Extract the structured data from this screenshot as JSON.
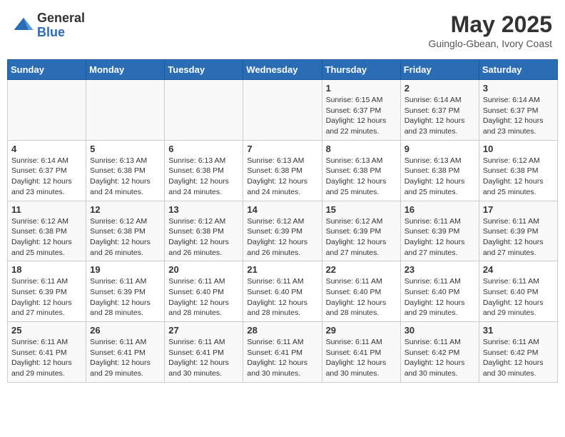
{
  "header": {
    "logo_general": "General",
    "logo_blue": "Blue",
    "month_title": "May 2025",
    "subtitle": "Guinglo-Gbean, Ivory Coast"
  },
  "weekdays": [
    "Sunday",
    "Monday",
    "Tuesday",
    "Wednesday",
    "Thursday",
    "Friday",
    "Saturday"
  ],
  "weeks": [
    [
      {
        "day": "",
        "info": ""
      },
      {
        "day": "",
        "info": ""
      },
      {
        "day": "",
        "info": ""
      },
      {
        "day": "",
        "info": ""
      },
      {
        "day": "1",
        "info": "Sunrise: 6:15 AM\nSunset: 6:37 PM\nDaylight: 12 hours\nand 22 minutes."
      },
      {
        "day": "2",
        "info": "Sunrise: 6:14 AM\nSunset: 6:37 PM\nDaylight: 12 hours\nand 23 minutes."
      },
      {
        "day": "3",
        "info": "Sunrise: 6:14 AM\nSunset: 6:37 PM\nDaylight: 12 hours\nand 23 minutes."
      }
    ],
    [
      {
        "day": "4",
        "info": "Sunrise: 6:14 AM\nSunset: 6:37 PM\nDaylight: 12 hours\nand 23 minutes."
      },
      {
        "day": "5",
        "info": "Sunrise: 6:13 AM\nSunset: 6:38 PM\nDaylight: 12 hours\nand 24 minutes."
      },
      {
        "day": "6",
        "info": "Sunrise: 6:13 AM\nSunset: 6:38 PM\nDaylight: 12 hours\nand 24 minutes."
      },
      {
        "day": "7",
        "info": "Sunrise: 6:13 AM\nSunset: 6:38 PM\nDaylight: 12 hours\nand 24 minutes."
      },
      {
        "day": "8",
        "info": "Sunrise: 6:13 AM\nSunset: 6:38 PM\nDaylight: 12 hours\nand 25 minutes."
      },
      {
        "day": "9",
        "info": "Sunrise: 6:13 AM\nSunset: 6:38 PM\nDaylight: 12 hours\nand 25 minutes."
      },
      {
        "day": "10",
        "info": "Sunrise: 6:12 AM\nSunset: 6:38 PM\nDaylight: 12 hours\nand 25 minutes."
      }
    ],
    [
      {
        "day": "11",
        "info": "Sunrise: 6:12 AM\nSunset: 6:38 PM\nDaylight: 12 hours\nand 25 minutes."
      },
      {
        "day": "12",
        "info": "Sunrise: 6:12 AM\nSunset: 6:38 PM\nDaylight: 12 hours\nand 26 minutes."
      },
      {
        "day": "13",
        "info": "Sunrise: 6:12 AM\nSunset: 6:38 PM\nDaylight: 12 hours\nand 26 minutes."
      },
      {
        "day": "14",
        "info": "Sunrise: 6:12 AM\nSunset: 6:39 PM\nDaylight: 12 hours\nand 26 minutes."
      },
      {
        "day": "15",
        "info": "Sunrise: 6:12 AM\nSunset: 6:39 PM\nDaylight: 12 hours\nand 27 minutes."
      },
      {
        "day": "16",
        "info": "Sunrise: 6:11 AM\nSunset: 6:39 PM\nDaylight: 12 hours\nand 27 minutes."
      },
      {
        "day": "17",
        "info": "Sunrise: 6:11 AM\nSunset: 6:39 PM\nDaylight: 12 hours\nand 27 minutes."
      }
    ],
    [
      {
        "day": "18",
        "info": "Sunrise: 6:11 AM\nSunset: 6:39 PM\nDaylight: 12 hours\nand 27 minutes."
      },
      {
        "day": "19",
        "info": "Sunrise: 6:11 AM\nSunset: 6:39 PM\nDaylight: 12 hours\nand 28 minutes."
      },
      {
        "day": "20",
        "info": "Sunrise: 6:11 AM\nSunset: 6:40 PM\nDaylight: 12 hours\nand 28 minutes."
      },
      {
        "day": "21",
        "info": "Sunrise: 6:11 AM\nSunset: 6:40 PM\nDaylight: 12 hours\nand 28 minutes."
      },
      {
        "day": "22",
        "info": "Sunrise: 6:11 AM\nSunset: 6:40 PM\nDaylight: 12 hours\nand 28 minutes."
      },
      {
        "day": "23",
        "info": "Sunrise: 6:11 AM\nSunset: 6:40 PM\nDaylight: 12 hours\nand 29 minutes."
      },
      {
        "day": "24",
        "info": "Sunrise: 6:11 AM\nSunset: 6:40 PM\nDaylight: 12 hours\nand 29 minutes."
      }
    ],
    [
      {
        "day": "25",
        "info": "Sunrise: 6:11 AM\nSunset: 6:41 PM\nDaylight: 12 hours\nand 29 minutes."
      },
      {
        "day": "26",
        "info": "Sunrise: 6:11 AM\nSunset: 6:41 PM\nDaylight: 12 hours\nand 29 minutes."
      },
      {
        "day": "27",
        "info": "Sunrise: 6:11 AM\nSunset: 6:41 PM\nDaylight: 12 hours\nand 30 minutes."
      },
      {
        "day": "28",
        "info": "Sunrise: 6:11 AM\nSunset: 6:41 PM\nDaylight: 12 hours\nand 30 minutes."
      },
      {
        "day": "29",
        "info": "Sunrise: 6:11 AM\nSunset: 6:41 PM\nDaylight: 12 hours\nand 30 minutes."
      },
      {
        "day": "30",
        "info": "Sunrise: 6:11 AM\nSunset: 6:42 PM\nDaylight: 12 hours\nand 30 minutes."
      },
      {
        "day": "31",
        "info": "Sunrise: 6:11 AM\nSunset: 6:42 PM\nDaylight: 12 hours\nand 30 minutes."
      }
    ]
  ]
}
